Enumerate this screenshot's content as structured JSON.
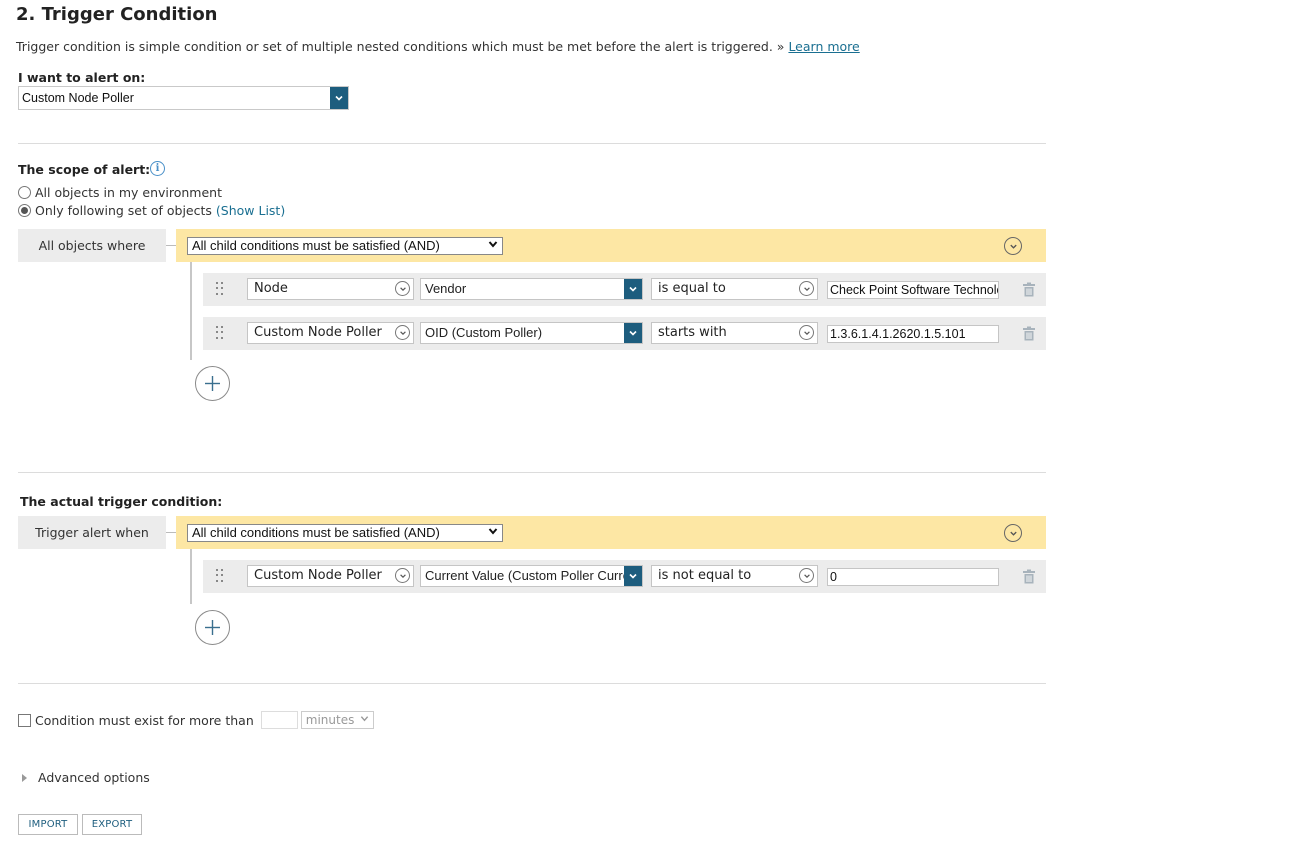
{
  "section": {
    "title": "2. Trigger Condition",
    "description": "Trigger condition is simple condition or set of multiple nested conditions which must be met before the alert is triggered. »",
    "learn_more": "Learn more"
  },
  "alert_on": {
    "label": "I want to alert on:",
    "value": "Custom Node Poller"
  },
  "scope": {
    "label": "The scope of alert:",
    "option_all": "All objects in my environment",
    "option_following": "Only following set of objects",
    "show_list": "(Show List)",
    "selected": "following",
    "group_label": "All objects where",
    "group_operator": "All child conditions must be satisfied (AND)",
    "conditions": [
      {
        "object": "Node",
        "field": "Vendor",
        "operator": "is equal to",
        "value": "Check Point Software Technologies"
      },
      {
        "object": "Custom Node Poller",
        "field": "OID (Custom Poller)",
        "operator": "starts with",
        "value": "1.3.6.1.4.1.2620.1.5.101"
      }
    ]
  },
  "trigger": {
    "label": "The actual trigger condition:",
    "group_label": "Trigger alert when",
    "group_operator": "All child conditions must be satisfied (AND)",
    "conditions": [
      {
        "object": "Custom Node Poller",
        "field": "Current Value (Custom Poller Current Value)",
        "operator": "is not equal to",
        "value": "0"
      }
    ]
  },
  "duration": {
    "label": "Condition must exist for more than",
    "value": "",
    "unit": "minutes",
    "checked": false
  },
  "advanced": {
    "label": "Advanced options"
  },
  "buttons": {
    "import": "IMPORT",
    "export": "EXPORT"
  },
  "colors": {
    "accent": "#1d5d7e",
    "group_bar": "#fde7a4",
    "link": "#1a6f91"
  }
}
